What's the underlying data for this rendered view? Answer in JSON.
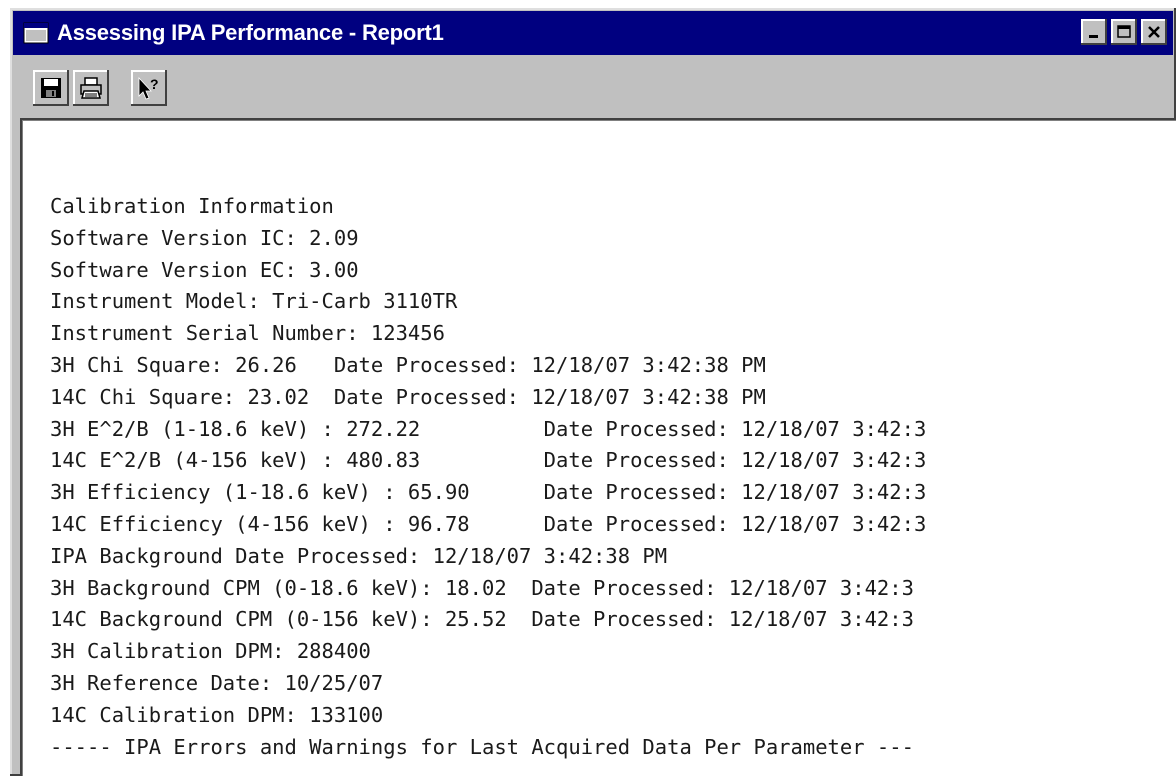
{
  "window": {
    "title": "Assessing IPA Performance - Report1"
  },
  "toolbar": {
    "buttons": [
      {
        "icon": "save-icon"
      },
      {
        "icon": "print-icon"
      },
      {
        "icon": "context-help-icon"
      }
    ]
  },
  "report": {
    "lines": [
      "Calibration Information",
      "Software Version IC: 2.09",
      "Software Version EC: 3.00",
      "Instrument Model: Tri-Carb 3110TR",
      "Instrument Serial Number: 123456",
      "3H Chi Square: 26.26   Date Processed: 12/18/07 3:42:38 PM",
      "14C Chi Square: 23.02  Date Processed: 12/18/07 3:42:38 PM",
      "3H E^2/B (1-18.6 keV) : 272.22          Date Processed: 12/18/07 3:42:3",
      "14C E^2/B (4-156 keV) : 480.83          Date Processed: 12/18/07 3:42:3",
      "3H Efficiency (1-18.6 keV) : 65.90      Date Processed: 12/18/07 3:42:3",
      "14C Efficiency (4-156 keV) : 96.78      Date Processed: 12/18/07 3:42:3",
      "IPA Background Date Processed: 12/18/07 3:42:38 PM",
      "3H Background CPM (0-18.6 keV): 18.02  Date Processed: 12/18/07 3:42:3",
      "14C Background CPM (0-156 keV): 25.52  Date Processed: 12/18/07 3:42:3",
      "3H Calibration DPM: 288400",
      "3H Reference Date: 10/25/07",
      "14C Calibration DPM: 133100",
      "----- IPA Errors and Warnings for Last Acquired Data Per Parameter ---"
    ]
  }
}
